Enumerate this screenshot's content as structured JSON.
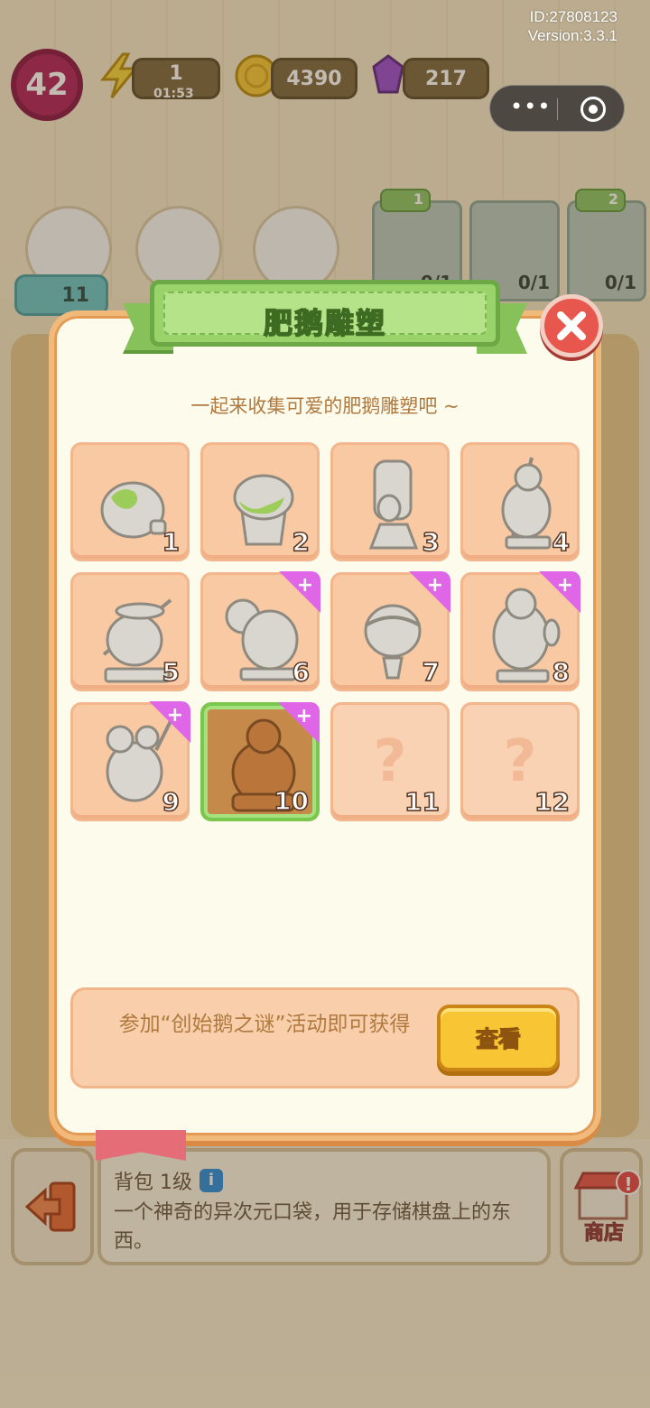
{
  "system": {
    "id": "ID:27808123",
    "version": "Version:3.3.1"
  },
  "hud": {
    "level": "42",
    "energy": {
      "value": "1",
      "timer": "01:53"
    },
    "coins": "4390",
    "gems": "217",
    "star_count": "11"
  },
  "top_cards": [
    {
      "stars": "1",
      "count": "0/1"
    },
    {
      "stars": "",
      "count": "0/1"
    },
    {
      "stars": "2",
      "count": "0/1"
    }
  ],
  "modal": {
    "title": "肥鹅雕塑",
    "subtitle": "一起来收集可爱的肥鹅雕塑吧 ~",
    "items": [
      {
        "number": "1",
        "state": "collected",
        "plus_tag": false
      },
      {
        "number": "2",
        "state": "collected",
        "plus_tag": false
      },
      {
        "number": "3",
        "state": "collected",
        "plus_tag": false
      },
      {
        "number": "4",
        "state": "collected",
        "plus_tag": false
      },
      {
        "number": "5",
        "state": "collected",
        "plus_tag": false
      },
      {
        "number": "6",
        "state": "collected",
        "plus_tag": true
      },
      {
        "number": "7",
        "state": "collected",
        "plus_tag": true
      },
      {
        "number": "8",
        "state": "collected",
        "plus_tag": true
      },
      {
        "number": "9",
        "state": "collected",
        "plus_tag": true
      },
      {
        "number": "10",
        "state": "selected",
        "plus_tag": true
      },
      {
        "number": "11",
        "state": "locked",
        "plus_tag": false
      },
      {
        "number": "12",
        "state": "locked",
        "plus_tag": false
      }
    ],
    "locked_symbol": "?",
    "footer_text": "参加“创始鹅之谜”活动即可获得",
    "view_button": "查看"
  },
  "info_bar": {
    "title": "背包 1级",
    "info_icon": "i",
    "description": "一个神奇的异次元口袋，用于存储棋盘上的东西。",
    "shop_label": "商店",
    "shop_alert": "!"
  },
  "colors": {
    "modal_bg": "#fdfbec",
    "ribbon_green": "#9bd36b",
    "cell_peach": "#f8c9a3",
    "selected_border": "#79c74d",
    "tag_pink": "#e066e8",
    "button_yellow": "#f8c534",
    "close_red": "#e8574e"
  }
}
